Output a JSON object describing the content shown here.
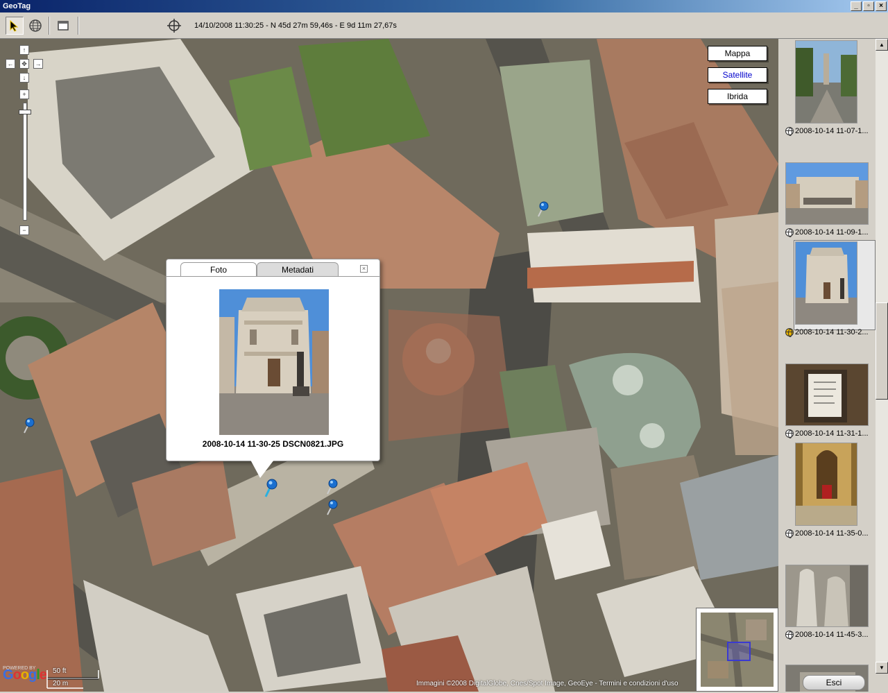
{
  "window": {
    "title": "GeoTag",
    "buttons": [
      "_",
      "▫",
      "×"
    ]
  },
  "toolbar": {
    "tools": [
      "select-arrow-icon",
      "globe-icon",
      "window-icon",
      "crosshair-icon"
    ],
    "coordinates_text": "14/10/2008 11:30:25 - N 45d 27m 59,46s - E 9d 11m 27,67s"
  },
  "map": {
    "nav": {
      "up": "↑",
      "down": "↓",
      "left": "←",
      "right": "→",
      "center": "✥",
      "zoom_in": "+",
      "zoom_out": "−"
    },
    "map_types": [
      {
        "label": "Mappa",
        "selected": false
      },
      {
        "label": "Satellite",
        "selected": true
      },
      {
        "label": "Ibrida",
        "selected": false
      }
    ],
    "copyright": "Immagini ©2008 DigitalGlobe, Cnes/Spot Image, GeoEye - Termini e condizioni d'uso",
    "logo": "Google",
    "logo_sub": "POWERED BY",
    "scale": {
      "feet": "50 ft",
      "meters": "20 m"
    }
  },
  "popup": {
    "tabs": [
      {
        "label": "Foto",
        "active": true
      },
      {
        "label": "Metadati",
        "active": false
      }
    ],
    "close": "×",
    "caption": "2008-10-14 11-30-25 DSCN0821.JPG"
  },
  "sidebar": {
    "items": [
      {
        "label": "2008-10-14 11-07-1...",
        "selected": false
      },
      {
        "label": "2008-10-14 11-09-1...",
        "selected": false
      },
      {
        "label": "2008-10-14 11-30-2...",
        "selected": true
      },
      {
        "label": "2008-10-14 11-31-1...",
        "selected": false
      },
      {
        "label": "2008-10-14 11-35-0...",
        "selected": false
      },
      {
        "label": "2008-10-14 11-45-3...",
        "selected": false
      }
    ],
    "exit_label": "Esci"
  },
  "colors": {
    "titlebar": "#0a246a",
    "selected_maptype": "#0000cc",
    "pin": "#1a6fd0"
  }
}
